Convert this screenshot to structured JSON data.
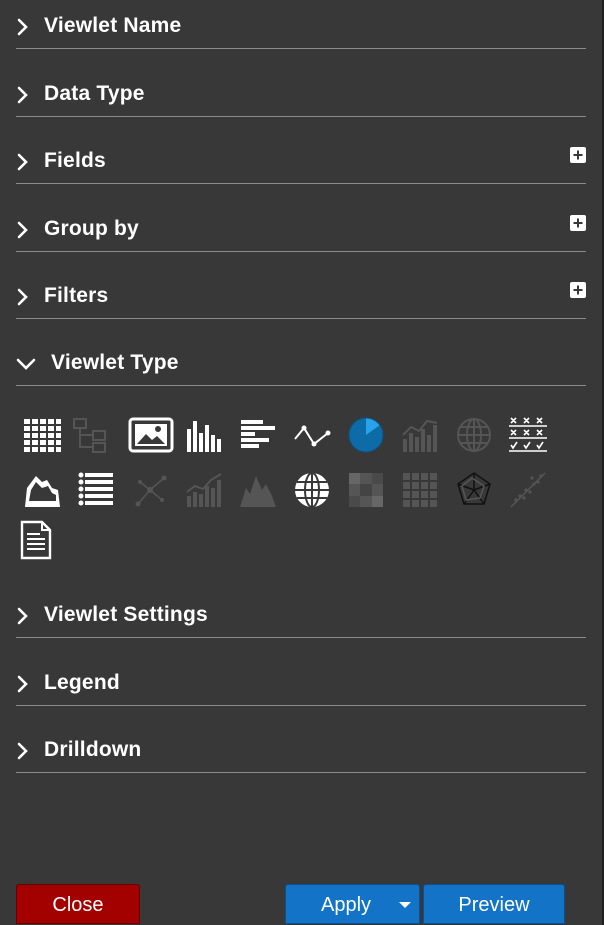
{
  "sections": {
    "viewlet_name": "Viewlet Name",
    "data_type": "Data Type",
    "fields": "Fields",
    "group_by": "Group by",
    "filters": "Filters",
    "viewlet_type": "Viewlet Type",
    "viewlet_settings": "Viewlet Settings",
    "legend": "Legend",
    "drilldown": "Drilldown"
  },
  "viewlet_type_icons": [
    {
      "name": "grid-table",
      "enabled": true
    },
    {
      "name": "tree-hierarchy",
      "enabled": false
    },
    {
      "name": "image",
      "enabled": true
    },
    {
      "name": "column-chart",
      "enabled": true
    },
    {
      "name": "bar-chart",
      "enabled": true
    },
    {
      "name": "line-chart",
      "enabled": true
    },
    {
      "name": "pie-chart",
      "enabled": true,
      "selected": true,
      "color": "#1a8fd6"
    },
    {
      "name": "combo-chart",
      "enabled": false
    },
    {
      "name": "globe-map",
      "enabled": false
    },
    {
      "name": "checklist-matrix",
      "enabled": true
    },
    {
      "name": "area-chart",
      "enabled": true
    },
    {
      "name": "list",
      "enabled": true
    },
    {
      "name": "network-graph",
      "enabled": false
    },
    {
      "name": "bar-line-chart",
      "enabled": false
    },
    {
      "name": "mountain-chart",
      "enabled": false
    },
    {
      "name": "globe-map",
      "enabled": true
    },
    {
      "name": "heatmap",
      "enabled": false
    },
    {
      "name": "grid-matrix",
      "enabled": false
    },
    {
      "name": "radar-chart",
      "enabled": false
    },
    {
      "name": "scatter-chart",
      "enabled": false
    },
    {
      "name": "document",
      "enabled": true
    }
  ],
  "buttons": {
    "close": "Close",
    "apply": "Apply",
    "preview": "Preview"
  },
  "colors": {
    "background": "#383838",
    "close_button": "#a30000",
    "primary_button": "#1273c7",
    "selected_icon": "#1a8fd6",
    "disabled_icon": "#555555"
  }
}
